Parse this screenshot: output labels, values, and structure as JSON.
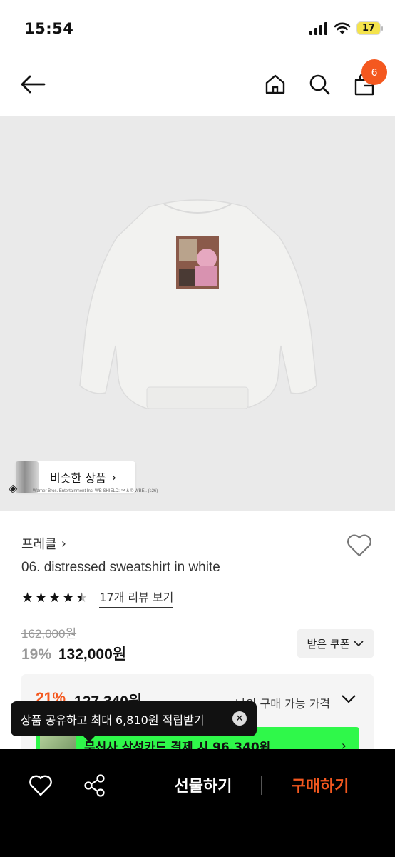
{
  "status_bar": {
    "time": "15:54",
    "battery": "17"
  },
  "nav": {
    "cart_count": "6"
  },
  "image": {
    "similar_label": "비슷한 상품",
    "copyright": "Warner Bros. Entertainment Inc. WB SHIELD: ™ & © WBEI. (s26)"
  },
  "product": {
    "brand": "프레클",
    "name": "06. distressed sweatshirt in white",
    "rating": 4.5,
    "review_link": "17개 리뷰 보기",
    "original_price": "162,000원",
    "discount_rate": "19%",
    "price": "132,000원",
    "coupon_label": "받은 쿠폰"
  },
  "my_price": {
    "rate": "21%",
    "value": "127,340원",
    "label": "나의 구매 가능 가격",
    "card_text": "무신사 삼성카드 결제 시 96,340원"
  },
  "toast": {
    "text": "상품 공유하고 최대 6,810원 적립받기"
  },
  "bottom_bar": {
    "gift_label": "선물하기",
    "buy_label": "구매하기"
  },
  "colors": {
    "accent": "#f4581f",
    "card_banner": "#2ff84a",
    "bottom_bar": "#000000"
  }
}
